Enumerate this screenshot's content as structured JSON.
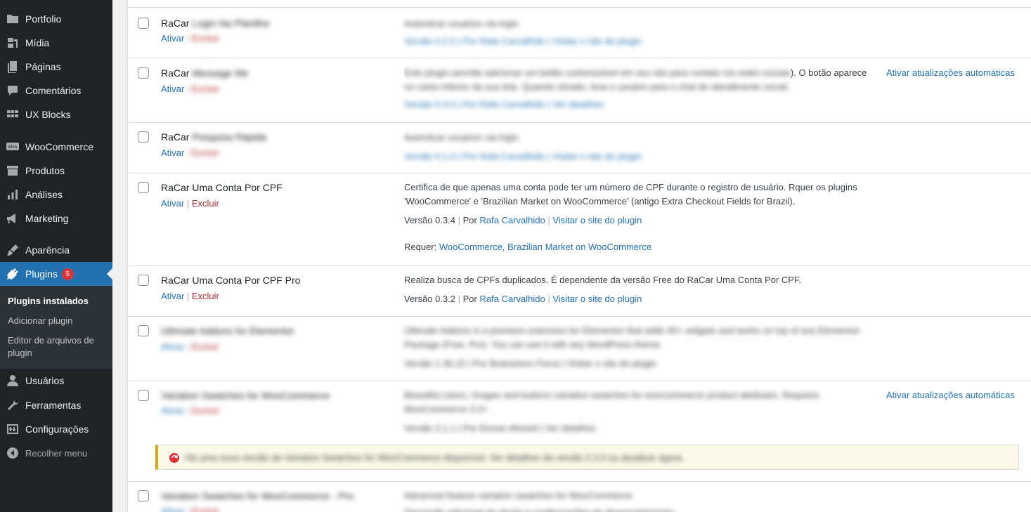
{
  "sidebar": {
    "items": [
      {
        "label": "Portfolio",
        "icon": "folder-icon"
      },
      {
        "label": "Mídia",
        "icon": "media-icon"
      },
      {
        "label": "Páginas",
        "icon": "pages-icon"
      },
      {
        "label": "Comentários",
        "icon": "comments-icon"
      },
      {
        "label": "UX Blocks",
        "icon": "grid-icon"
      },
      {
        "label": "WooCommerce",
        "icon": "woo-icon"
      },
      {
        "label": "Produtos",
        "icon": "archive-icon"
      },
      {
        "label": "Análises",
        "icon": "chart-icon"
      },
      {
        "label": "Marketing",
        "icon": "megaphone-icon"
      },
      {
        "label": "Aparência",
        "icon": "brush-icon"
      },
      {
        "label": "Plugins",
        "icon": "plugin-icon",
        "badge": "5"
      },
      {
        "label": "Usuários",
        "icon": "user-icon"
      },
      {
        "label": "Ferramentas",
        "icon": "wrench-icon"
      },
      {
        "label": "Configurações",
        "icon": "settings-icon"
      },
      {
        "label": "Recolher menu",
        "icon": "collapse-icon"
      }
    ],
    "submenu": {
      "installed": "Plugins instalados",
      "add": "Adicionar plugin",
      "editor": "Editor de arquivos de plugin"
    }
  },
  "common": {
    "activate": "Ativar",
    "delete": "Excluir",
    "sep": "|",
    "by": "Por",
    "site": "Visitar o site do plugin",
    "auto_updates": "Ativar atualizações automáticas"
  },
  "plugins": {
    "r1": {
      "name_prefix": "RaCar",
      "name_blur": "Login Na Planilha",
      "desc_blur": "Autenticar usuários via login",
      "meta_blur": "Versão 0.2.0 | Por Rafa Carvalhido | Visitar o site do plugin"
    },
    "r2": {
      "name_prefix": "RaCar",
      "name_blur": "Message Me",
      "desc_blur": "Este plugin permite adicionar um botão customizável em seu site para contato via redes sociais",
      "desc_tail": "). O botão aparece",
      "desc_blur2": "no canto inferior da sua tela. Quando clicado, leva o usuário para o chat de atendimento social.",
      "meta_blur": "Versão 0.4.0 | Por Rafa Carvalhido | Ver detalhes"
    },
    "r3": {
      "name_prefix": "RaCar",
      "name_blur": "Pesquisa Rápida",
      "desc_blur": "Autenticar usuários via login",
      "meta_blur": "Versão 0.1.0 | Por Rafa Carvalhido | Visitar o site do plugin"
    },
    "r4": {
      "name": "RaCar Uma Conta Por CPF",
      "desc": "Certifica de que apenas uma conta pode ter um número de CPF durante o registro de usuário. Rquer os plugins 'WooCommerce' e 'Brazilian Market on WooCommerce' (antigo Extra Checkout Fields for Brazil).",
      "version": "Versão 0.3.4",
      "author": "Rafa Carvalhido",
      "requires_label": "Requer:",
      "requires": "WooCommerce, Brazilian Market on WooCommerce"
    },
    "r5": {
      "name": "RaCar Uma Conta Por CPF Pro",
      "desc": "Realiza busca de CPFs duplicados. É dependente da versão Free do RaCar Uma Conta Por CPF.",
      "version": "Versão 0.3.2",
      "author": "Rafa Carvalhido"
    },
    "r6": {
      "name_blur": "Ultimate Addons for Elementor",
      "desc_blur": "Ultimate Addons is a premium extension for Elementor that adds 40+ widgets and works on top of any Elementor Package (Free, Pro). You can use it with any WordPress theme.",
      "meta_blur": "Versão 1.36.22 | Por Brainstorm Force | Visitar o site do plugin"
    },
    "r7": {
      "name_blur": "Variation Swatches for WooCommerce",
      "desc_blur": "Beautiful colors, images and buttons variation swatches for woocommerce product attributes. Requires WooCommerce 3.2+",
      "meta_blur": "Versão 2.1.1 | Por Emran Ahmed | Ver detalhes",
      "notice_blur": "Há uma nova versão do Variation Swatches for WooCommerce disponível. Ver detalhes da versão 2.2.0 ou atualizar agora."
    },
    "r8": {
      "name_blur": "Variation Swatches for WooCommerce - Pro",
      "desc_blur": "Advanced feature variation swatches for WooCommerce",
      "desc_blur2": "Descrição adicional do plugin e configurações de desenvolvimento."
    }
  }
}
